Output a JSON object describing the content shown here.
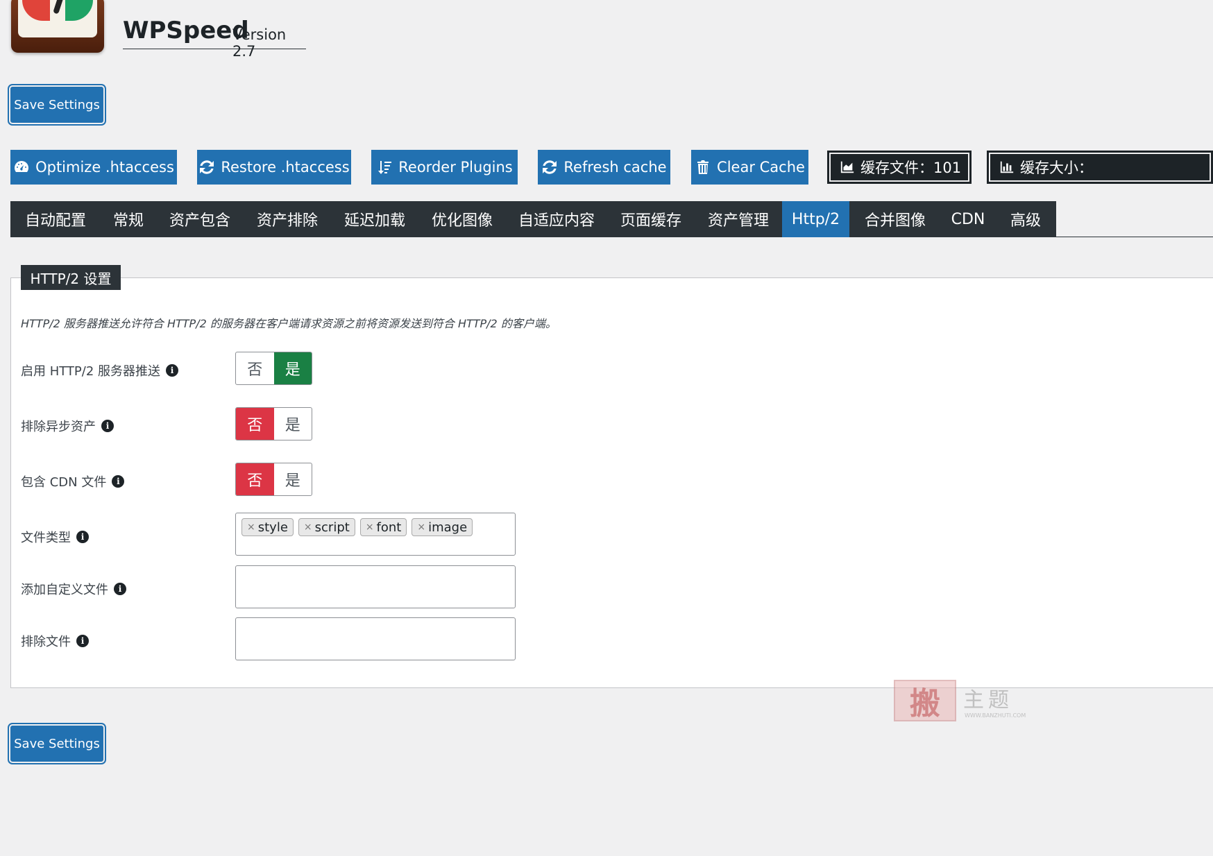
{
  "header": {
    "app_name": "WPSpeed",
    "version": "Version 2.7"
  },
  "actions": {
    "save_label": "Save Settings"
  },
  "toolbar": [
    {
      "label": "Optimize .htaccess",
      "icon": "gauge-icon"
    },
    {
      "label": "Restore .htaccess",
      "icon": "refresh-icon"
    },
    {
      "label": "Reorder Plugins",
      "icon": "sort-icon"
    },
    {
      "label": "Refresh cache",
      "icon": "refresh-icon"
    },
    {
      "label": "Clear Cache",
      "icon": "trash-icon"
    }
  ],
  "stats": [
    {
      "label": "缓存文件：101",
      "icon": "area-chart-icon"
    },
    {
      "label": "缓存大小：",
      "icon": "bar-chart-icon"
    }
  ],
  "tabs": [
    {
      "label": "自动配置"
    },
    {
      "label": "常规"
    },
    {
      "label": "资产包含"
    },
    {
      "label": "资产排除"
    },
    {
      "label": "延迟加载"
    },
    {
      "label": "优化图像"
    },
    {
      "label": "自适应内容"
    },
    {
      "label": "页面缓存"
    },
    {
      "label": "资产管理"
    },
    {
      "label": "Http/2",
      "active": true
    },
    {
      "label": "合并图像"
    },
    {
      "label": "CDN"
    },
    {
      "label": "高级"
    }
  ],
  "panel": {
    "legend": "HTTP/2 设置",
    "description": "HTTP/2 服务器推送允许符合 HTTP/2 的服务器在客户端请求资源之前将资源发送到符合 HTTP/2 的客户端。",
    "toggle_no": "否",
    "toggle_yes": "是",
    "settings": [
      {
        "label": "启用 HTTP/2 服务器推送",
        "value": "是"
      },
      {
        "label": "排除异步资产",
        "value": "否"
      },
      {
        "label": "包含 CDN 文件",
        "value": "否"
      },
      {
        "label": "文件类型"
      },
      {
        "label": "添加自定义文件"
      },
      {
        "label": "排除文件"
      }
    ],
    "file_types": [
      "style",
      "script",
      "font",
      "image"
    ],
    "info_glyph": "i",
    "tag_remove": "×"
  },
  "watermark": {
    "mark": "搬",
    "text": "主题",
    "url": "WWW.BANZHUTI.COM"
  },
  "colors": {
    "primary": "#2271b1",
    "dark": "#2c3338",
    "green": "#1a8044",
    "red": "#dc3545"
  }
}
